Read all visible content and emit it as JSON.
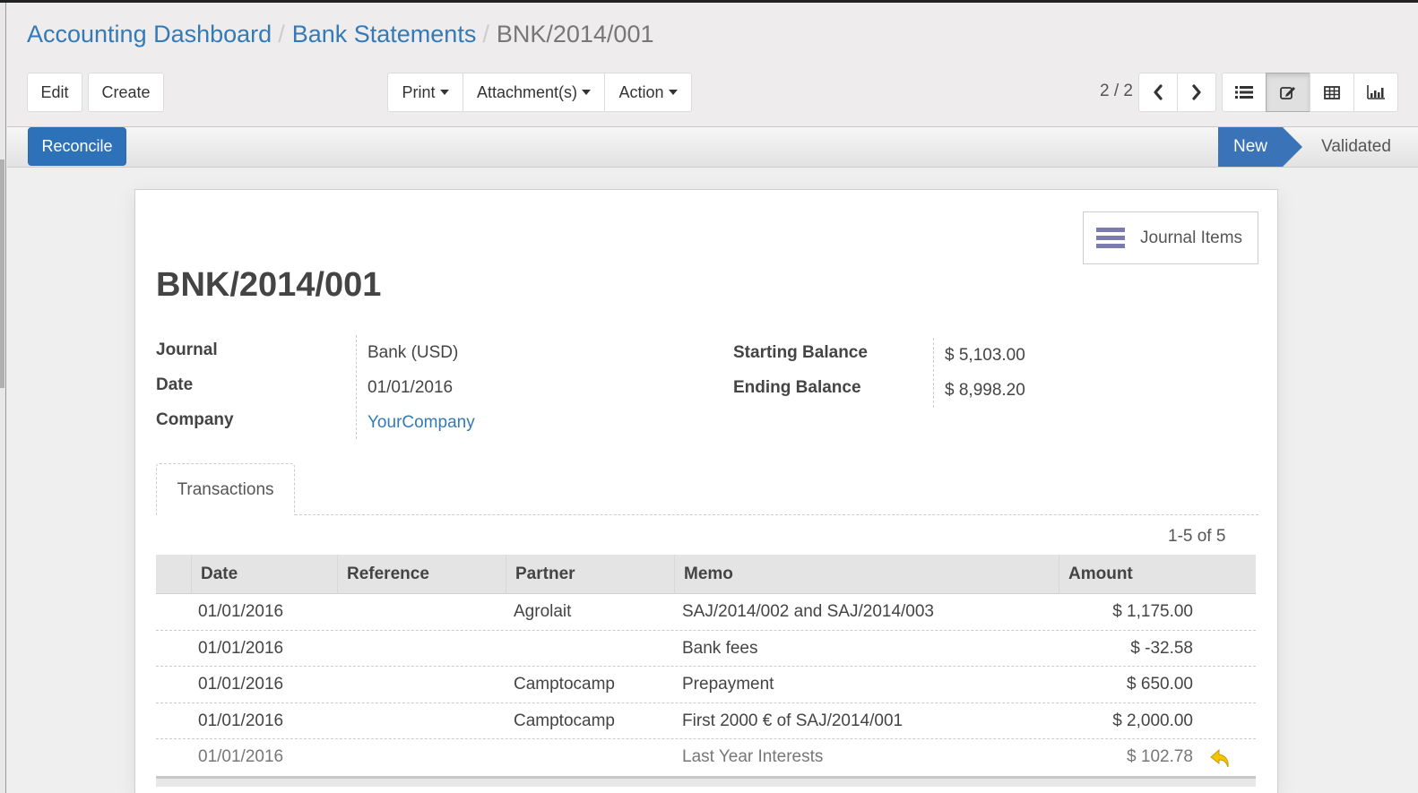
{
  "breadcrumb": {
    "items": [
      "Accounting Dashboard",
      "Bank Statements"
    ],
    "current": "BNK/2014/001"
  },
  "toolbar": {
    "edit_label": "Edit",
    "create_label": "Create",
    "print_label": "Print",
    "attachments_label": "Attachment(s)",
    "action_label": "Action"
  },
  "pager": {
    "value": "2 / 2",
    "prev_icon": "chevron-left-icon",
    "next_icon": "chevron-right-icon"
  },
  "view_switcher": {
    "views": [
      {
        "name": "list",
        "icon": "list-icon"
      },
      {
        "name": "form",
        "icon": "edit-icon",
        "active": true
      },
      {
        "name": "pivot",
        "icon": "table-icon"
      },
      {
        "name": "graph",
        "icon": "bar-chart-icon"
      }
    ]
  },
  "statusbar": {
    "reconcile_label": "Reconcile",
    "stages": [
      {
        "label": "New",
        "active": true
      },
      {
        "label": "Validated",
        "active": false
      }
    ]
  },
  "colors": {
    "primary": "#2d72b8",
    "link": "#337ab7",
    "smart_button_icon": "#7c7bad",
    "undo_icon": "#f2c500"
  },
  "record": {
    "title": "BNK/2014/001",
    "smart_button": {
      "label": "Journal Items",
      "icon": "list-icon"
    },
    "fields_left": [
      {
        "label": "Journal",
        "value": "Bank (USD)"
      },
      {
        "label": "Date",
        "value": "01/01/2016"
      },
      {
        "label": "Company",
        "value": "YourCompany"
      }
    ],
    "fields_right": [
      {
        "label": "Starting Balance",
        "value": "$ 5,103.00"
      },
      {
        "label": "Ending Balance",
        "value": "$ 8,998.20"
      }
    ]
  },
  "notebook": {
    "tabs": [
      {
        "label": "Transactions"
      }
    ],
    "pager": "1-5 of 5",
    "columns": [
      "Date",
      "Reference",
      "Partner",
      "Memo",
      "Amount"
    ],
    "rows": [
      {
        "date": "01/01/2016",
        "reference": "",
        "partner": "Agrolait",
        "memo": "SAJ/2014/002 and SAJ/2014/003",
        "amount": "$ 1,175.00"
      },
      {
        "date": "01/01/2016",
        "reference": "",
        "partner": "",
        "memo": "Bank fees",
        "amount": "$ -32.58"
      },
      {
        "date": "01/01/2016",
        "reference": "",
        "partner": "Camptocamp",
        "memo": "Prepayment",
        "amount": "$ 650.00"
      },
      {
        "date": "01/01/2016",
        "reference": "",
        "partner": "Camptocamp",
        "memo": "First 2000 € of SAJ/2014/001",
        "amount": "$ 2,000.00"
      },
      {
        "date": "01/01/2016",
        "reference": "",
        "partner": "",
        "memo": "Last Year Interests",
        "amount": "$ 102.78",
        "icon": "undo-icon"
      }
    ]
  }
}
